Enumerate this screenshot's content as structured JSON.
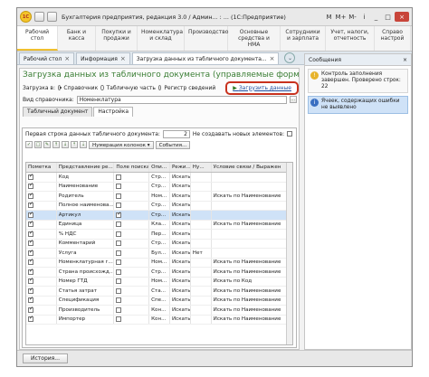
{
  "titlebar": {
    "logo_text": "1С",
    "title": "Бухгалтерия предприятия, редакция 3.0 / Админ... : ... (1С:Предприятие)",
    "buttons": [
      "M",
      "M+",
      "M-",
      "i",
      "_",
      "□",
      "×"
    ]
  },
  "sections": [
    {
      "line1": "Рабочий",
      "line2": "стол"
    },
    {
      "line1": "Банк и",
      "line2": "касса"
    },
    {
      "line1": "Покупки и",
      "line2": "продажи"
    },
    {
      "line1": "Номенклатура",
      "line2": "и склад"
    },
    {
      "line1": "Производство",
      "line2": ""
    },
    {
      "line1": "Основные",
      "line2": "средства и НМА"
    },
    {
      "line1": "Сотрудники",
      "line2": "и зарплата"
    },
    {
      "line1": "Учет, налоги,",
      "line2": "отчетность"
    },
    {
      "line1": "Справо",
      "line2": "настрой"
    }
  ],
  "open_tabs": [
    {
      "label": "Рабочий стол"
    },
    {
      "label": "Информация"
    },
    {
      "label": "Загрузка данных из табличного документа..."
    }
  ],
  "form": {
    "title": "Загрузка данных из табличного документа (управляемые формы)",
    "load_into_label": "Загрузка в:",
    "radio_options": [
      "Справочник",
      "Табличную часть",
      "Регистр сведений"
    ],
    "load_button": "Загрузить данные",
    "reference_type_label": "Вид справочника:",
    "reference_type_value": "Номенклатура"
  },
  "subtabs": [
    "Табличный документ",
    "Настройка"
  ],
  "settings": {
    "first_row_label": "Первая строка данных табличного документа:",
    "first_row_value": "2",
    "no_new_label": "Не создавать новых элементов:",
    "numbering_btn": "Нумерация колонок ▾",
    "events_btn": "События..."
  },
  "grid": {
    "headers": [
      "Пометка",
      "Представление ре...",
      "Поле поиска",
      "Опи...",
      "Режи...",
      "Ну...",
      "Условие связи / Выражен"
    ],
    "rows": [
      {
        "name": "Код",
        "search": false,
        "desc": "Стр...",
        "mode": "Искать",
        "num": "",
        "cond": ""
      },
      {
        "name": "Наименование",
        "search": false,
        "desc": "Стр...",
        "mode": "Искать",
        "num": "",
        "cond": ""
      },
      {
        "name": "Родитель",
        "search": false,
        "desc": "Ном...",
        "mode": "Искать",
        "num": "",
        "cond": "Искать по Наименование"
      },
      {
        "name": "Полное наименова...",
        "search": false,
        "desc": "Стр...",
        "mode": "Искать",
        "num": "",
        "cond": ""
      },
      {
        "name": "Артикул",
        "search": true,
        "desc": "Стр...",
        "mode": "Искать",
        "num": "",
        "cond": ""
      },
      {
        "name": "Единица",
        "search": false,
        "desc": "Кла...",
        "mode": "Искать",
        "num": "",
        "cond": "Искать по Наименование"
      },
      {
        "name": "% НДС",
        "search": false,
        "desc": "Пер...",
        "mode": "Искать",
        "num": "",
        "cond": ""
      },
      {
        "name": "Комментарий",
        "search": false,
        "desc": "Стр...",
        "mode": "Искать",
        "num": "",
        "cond": ""
      },
      {
        "name": "Услуга",
        "search": false,
        "desc": "Бул...",
        "mode": "Искать",
        "num": "Нет",
        "cond": ""
      },
      {
        "name": "Номенклатурная г...",
        "search": false,
        "desc": "Ном...",
        "mode": "Искать",
        "num": "",
        "cond": "Искать по Наименование"
      },
      {
        "name": "Страна происхожд...",
        "search": false,
        "desc": "Стр...",
        "mode": "Искать",
        "num": "",
        "cond": "Искать по Наименование"
      },
      {
        "name": "Номер ГТД",
        "search": false,
        "desc": "Ном...",
        "mode": "Искать",
        "num": "",
        "cond": "Искать по Код"
      },
      {
        "name": "Статья затрат",
        "search": false,
        "desc": "Ста...",
        "mode": "Искать",
        "num": "",
        "cond": "Искать по Наименование"
      },
      {
        "name": "Спецификация",
        "search": false,
        "desc": "Спе...",
        "mode": "Искать",
        "num": "",
        "cond": "Искать по Наименование"
      },
      {
        "name": "Производитель",
        "search": false,
        "desc": "Кон...",
        "mode": "Искать",
        "num": "",
        "cond": "Искать по Наименование"
      },
      {
        "name": "Импортер",
        "search": false,
        "desc": "Кон...",
        "mode": "Искать",
        "num": "",
        "cond": "Искать по Наименование"
      }
    ]
  },
  "messages": {
    "title": "Сообщения",
    "close": "×",
    "items": [
      {
        "text": "Контроль заполнения завершен. Проверено строк: 22"
      },
      {
        "text": "Ячеек, содержащих ошибки не выявлено"
      }
    ]
  },
  "statusbar": {
    "history_btn": "История..."
  }
}
